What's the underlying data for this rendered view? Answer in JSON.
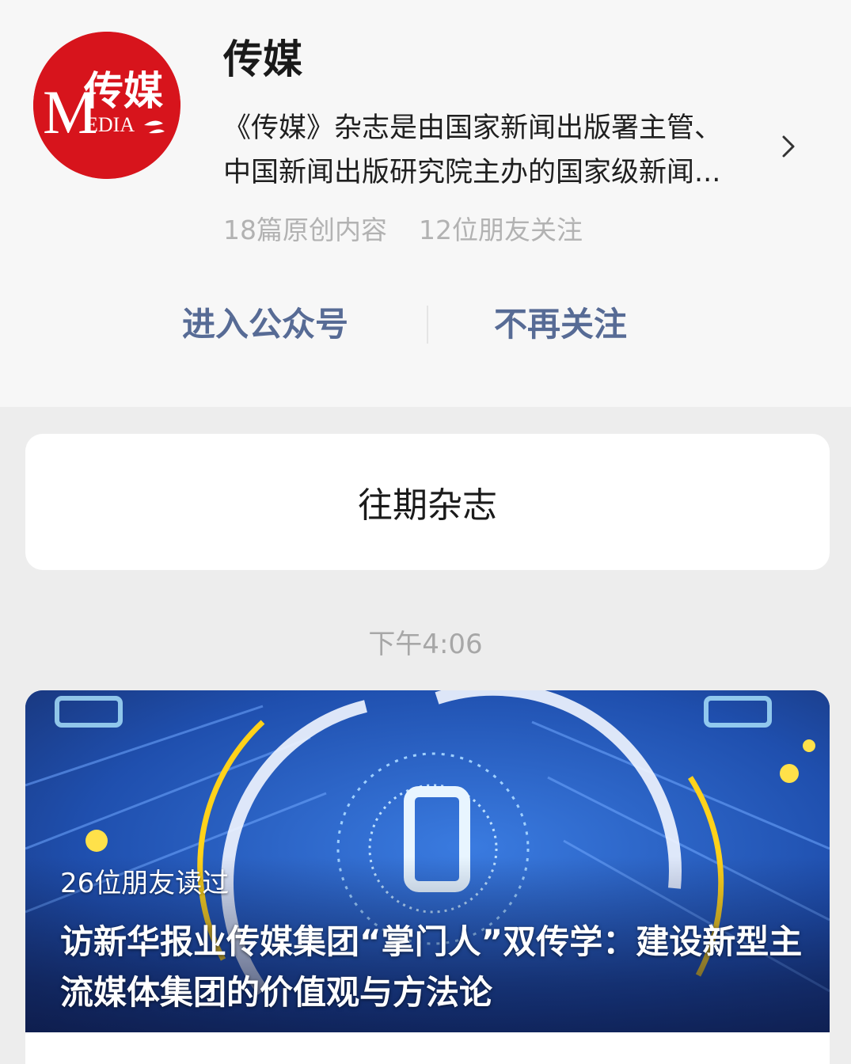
{
  "account": {
    "name": "传媒",
    "logo_text": "传媒",
    "logo_sub": "MEDIA",
    "description_line1": "《传媒》杂志是由国家新闻出版署主管、",
    "description_line2": "中国新闻出版研究院主办的国家级新闻...",
    "original_count": "18篇原创内容",
    "friends_following": "12位朋友关注"
  },
  "actions": {
    "enter": "进入公众号",
    "unfollow": "不再关注"
  },
  "back_issues": "往期杂志",
  "feed": {
    "timestamp": "下午4:06",
    "article": {
      "read_count": "26位朋友读过",
      "title": "访新华报业传媒集团“掌门人”双传学：建设新型主流媒体集团的价值观与方法论"
    }
  },
  "colors": {
    "link": "#576b95",
    "logo_red": "#d7141c",
    "muted": "#b2b2b2"
  }
}
